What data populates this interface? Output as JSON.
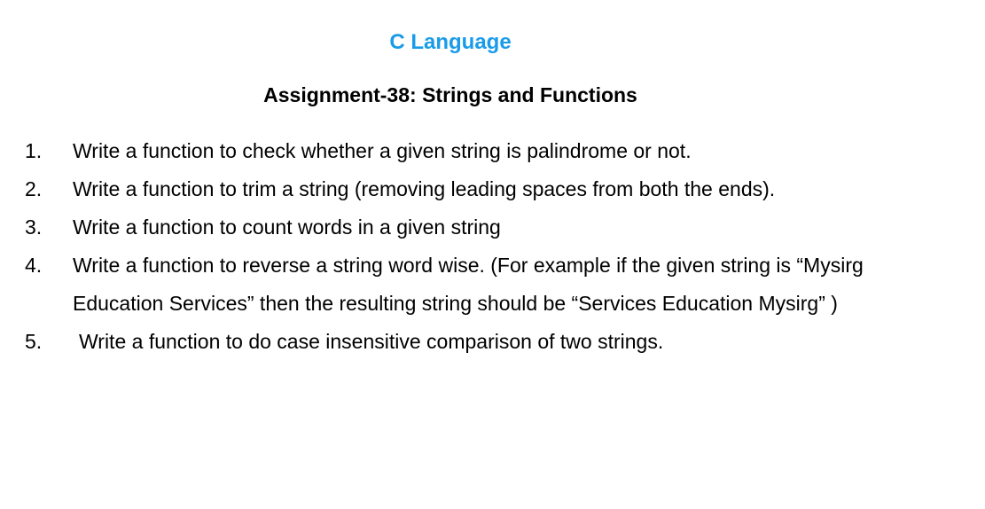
{
  "document": {
    "course_title": "C Language",
    "assignment_title": "Assignment-38: Strings and Functions",
    "title_color": "#1a9be8",
    "questions": [
      {
        "number": "1.",
        "text": "Write a function to check whether a given string is palindrome or not."
      },
      {
        "number": "2.",
        "text": "Write a function to trim a string (removing leading spaces from both the ends)."
      },
      {
        "number": "3.",
        "text": "Write a function to count words in a given string"
      },
      {
        "number": "4.",
        "text": "Write a function to reverse a string word wise. (For example if the given string is “Mysirg Education Services” then the resulting string should be “Services Education Mysirg” )"
      },
      {
        "number": "5.",
        "text": "Write a function to do case insensitive comparison of two strings."
      }
    ]
  }
}
